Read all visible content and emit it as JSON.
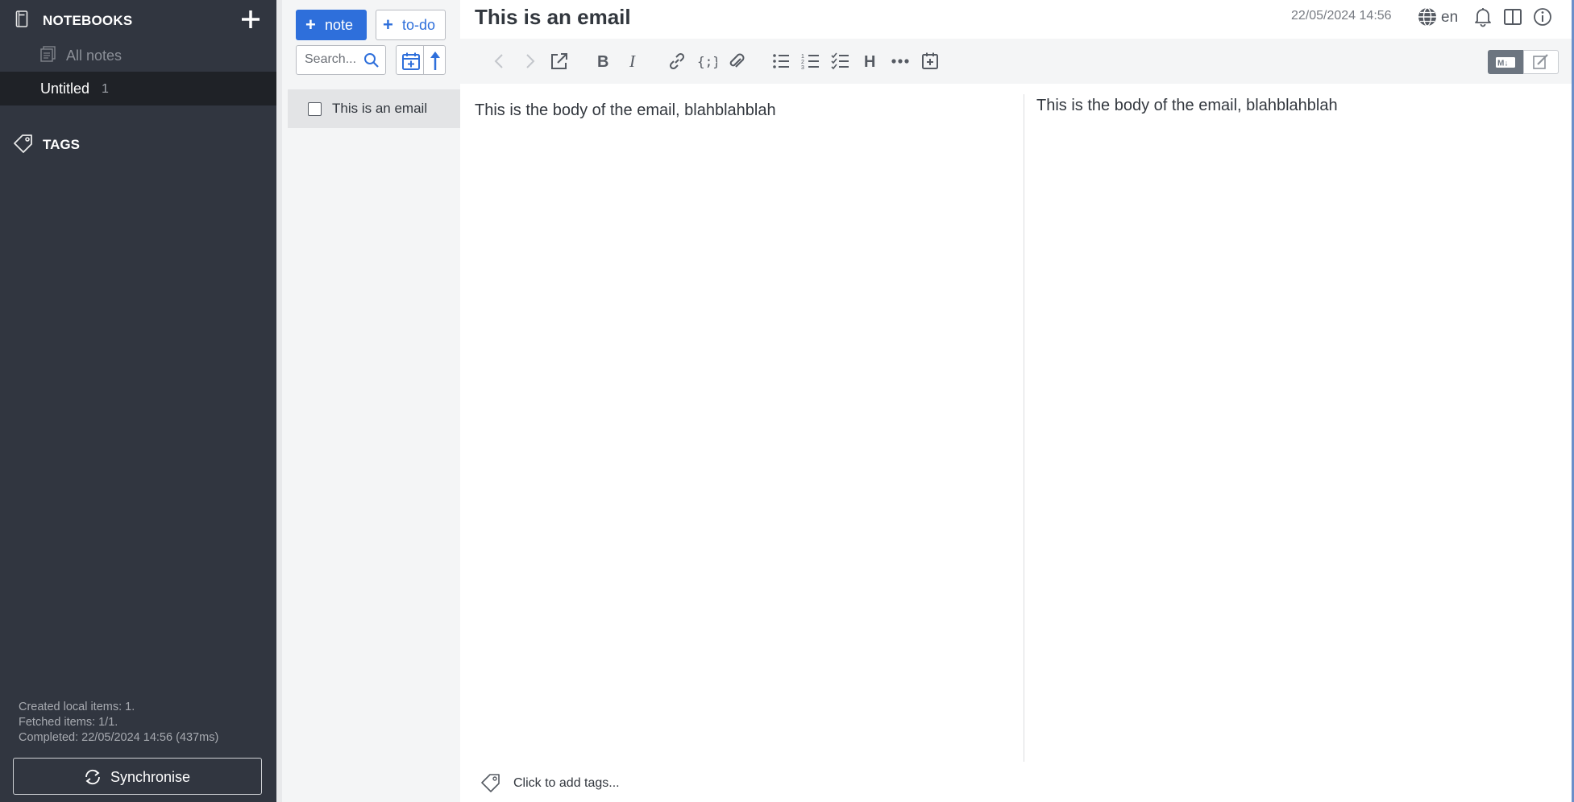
{
  "sidebar": {
    "notebooks_heading": "NOTEBOOKS",
    "all_notes": "All notes",
    "notebook": {
      "name": "Untitled",
      "count": "1"
    },
    "tags_heading": "TAGS",
    "status": {
      "line1": "Created local items: 1.",
      "line2": "Fetched items: 1/1.",
      "line3": "Completed: 22/05/2024 14:56 (437ms)"
    },
    "sync_label": "Synchronise"
  },
  "notelist": {
    "new_note_label": "note",
    "new_todo_label": "to-do",
    "search_placeholder": "Search...",
    "notes": [
      {
        "title": "This is an email"
      }
    ]
  },
  "editor": {
    "title": "This is an email",
    "date": "22/05/2024 14:56",
    "language": "en",
    "body_source": "This is the body of the email, blahblahblah",
    "body_rendered": "This is the body of the email, blahblahblah",
    "tags_hint": "Click to add tags...",
    "accent_color": "#2e6fdb"
  }
}
